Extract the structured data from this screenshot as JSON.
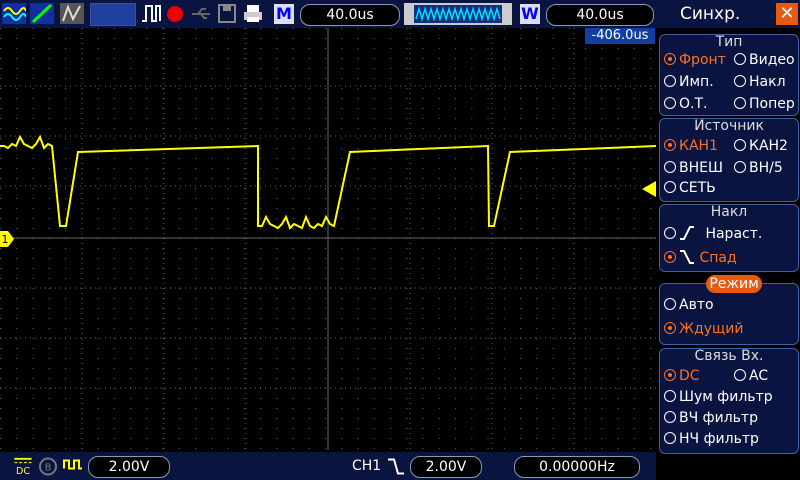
{
  "top": {
    "timebase": "40.0us",
    "window_label": "M",
    "delay_label": "W",
    "window_time": "40.0us"
  },
  "trigger_position": "-406.0us",
  "channel_marker": "1",
  "bottom": {
    "ch1_scale": "2.00V",
    "trigger_source": "CH1",
    "trigger_level": "2.00V",
    "frequency": "0.00000Hz"
  },
  "sidebar": {
    "title": "Синхр.",
    "type": {
      "heading": "Тип",
      "front": "Фронт",
      "video": "Видео",
      "pulse": "Имп.",
      "slope": "Накл",
      "ot": "О.Т.",
      "alt": "Попер"
    },
    "source": {
      "heading": "Источник",
      "ch1": "КАН1",
      "ch2": "КАН2",
      "ext": "ВНЕШ",
      "ext5": "ВН/5",
      "line": "СЕТЬ"
    },
    "slope": {
      "heading": "Накл",
      "rising": "Нараст.",
      "falling": "Спад"
    },
    "mode": {
      "heading": "Режим",
      "auto": "Авто",
      "normal": "Ждущий"
    },
    "coupling": {
      "heading": "Связь  Вх.",
      "dc": "DC",
      "ac": "AC",
      "noise": "Шум  фильтр",
      "hf": "ВЧ  фильтр",
      "lf": "НЧ  фильтр"
    }
  },
  "colors": {
    "trace": "#ffff00",
    "accent": "#ff7020",
    "bar": "#0a1440"
  }
}
